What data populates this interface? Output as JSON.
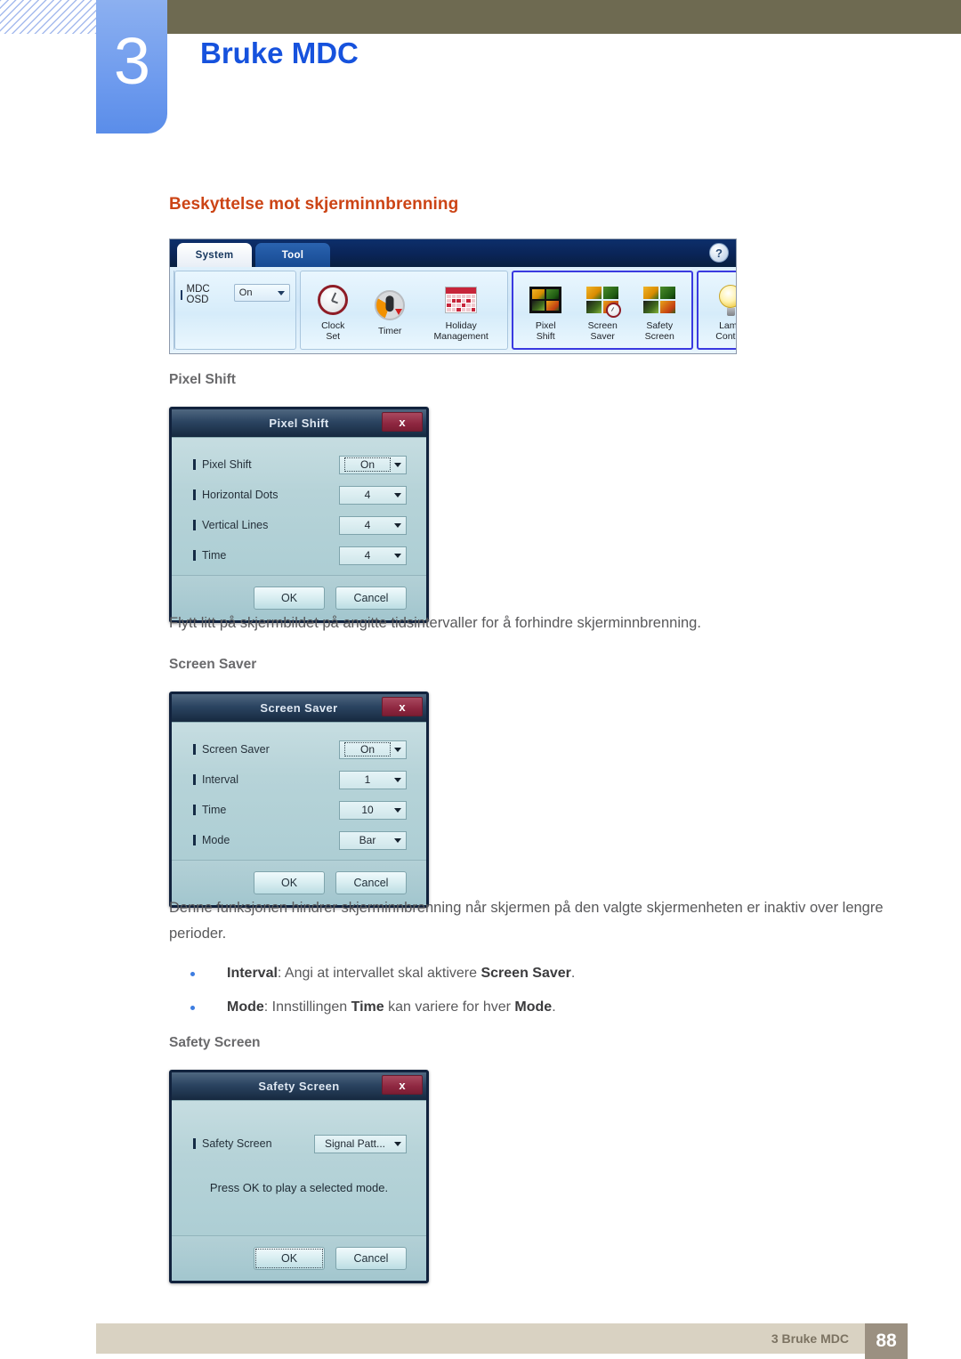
{
  "chapter": {
    "number": "3",
    "title": "Bruke MDC"
  },
  "section": {
    "heading": "Beskyttelse mot skjerminnbrenning"
  },
  "mdc_toolbar": {
    "tabs": [
      {
        "label": "System",
        "active": true
      },
      {
        "label": "Tool",
        "active": false
      }
    ],
    "help_icon": "?",
    "osd": {
      "label": "MDC OSD",
      "value": "On"
    },
    "groups": [
      {
        "highlighted": false,
        "items": [
          {
            "label_line1": "Clock",
            "label_line2": "Set",
            "icon": "clock-icon"
          },
          {
            "label_line1": "Timer",
            "label_line2": "",
            "icon": "timer-icon"
          },
          {
            "label_line1": "Holiday",
            "label_line2": "Management",
            "icon": "calendar-icon"
          }
        ]
      },
      {
        "highlighted": true,
        "items": [
          {
            "label_line1": "Pixel",
            "label_line2": "Shift",
            "icon": "pixel-shift-icon"
          },
          {
            "label_line1": "Screen",
            "label_line2": "Saver",
            "icon": "screen-saver-icon"
          },
          {
            "label_line1": "Safety",
            "label_line2": "Screen",
            "icon": "safety-screen-icon"
          }
        ]
      },
      {
        "highlighted": true,
        "items": [
          {
            "label_line1": "Lamp",
            "label_line2": "Control",
            "icon": "lamp-icon"
          }
        ]
      }
    ]
  },
  "pixel_shift": {
    "sub_heading": "Pixel Shift",
    "dialog": {
      "title": "Pixel Shift",
      "close_label": "x",
      "rows": [
        {
          "label": "Pixel Shift",
          "value": "On",
          "focused": true
        },
        {
          "label": "Horizontal Dots",
          "value": "4",
          "focused": false
        },
        {
          "label": "Vertical Lines",
          "value": "4",
          "focused": false
        },
        {
          "label": "Time",
          "value": "4",
          "focused": false
        }
      ],
      "ok_label": "OK",
      "cancel_label": "Cancel"
    },
    "description": "Flytt litt på skjermbildet på angitte tidsintervaller for å forhindre skjerminnbrenning."
  },
  "screen_saver": {
    "sub_heading": "Screen Saver",
    "dialog": {
      "title": "Screen Saver",
      "close_label": "x",
      "rows": [
        {
          "label": "Screen Saver",
          "value": "On",
          "focused": true
        },
        {
          "label": "Interval",
          "value": "1",
          "focused": false
        },
        {
          "label": "Time",
          "value": "10",
          "focused": false
        },
        {
          "label": "Mode",
          "value": "Bar",
          "focused": false
        }
      ],
      "ok_label": "OK",
      "cancel_label": "Cancel"
    },
    "description": "Denne funksjonen hindrer skjerminnbrenning når skjermen på den valgte skjermenheten er inaktiv over lengre perioder.",
    "bullets": [
      {
        "term": "Interval",
        "rest_1": ": Angi at intervallet skal aktivere ",
        "term_2": "Screen Saver",
        "rest_2": "."
      },
      {
        "term": "Mode",
        "rest_1": ": Innstillingen ",
        "term_2": "Time",
        "rest_2": " kan variere for hver ",
        "term_3": "Mode",
        "rest_3": "."
      }
    ]
  },
  "safety_screen": {
    "sub_heading": "Safety Screen",
    "dialog": {
      "title": "Safety Screen",
      "close_label": "x",
      "rows": [
        {
          "label": "Safety Screen",
          "value": "Signal Patt...",
          "focused": false
        }
      ],
      "message": "Press OK to play a selected mode.",
      "ok_label": "OK",
      "cancel_label": "Cancel"
    }
  },
  "footer": {
    "text": "3 Bruke MDC",
    "page": "88"
  },
  "colors": {
    "chapter_tab": "#6e9bee",
    "chapter_title": "#1652dd",
    "olive_bar": "#6e6a51",
    "section_heading": "#cc4415",
    "body_text": "#59595b",
    "bullet_dot": "#3d7de0",
    "footer_bar": "#d9d2c2",
    "footer_page_bg": "#9b9081",
    "dialog_highlight": "#3a3ae0"
  }
}
